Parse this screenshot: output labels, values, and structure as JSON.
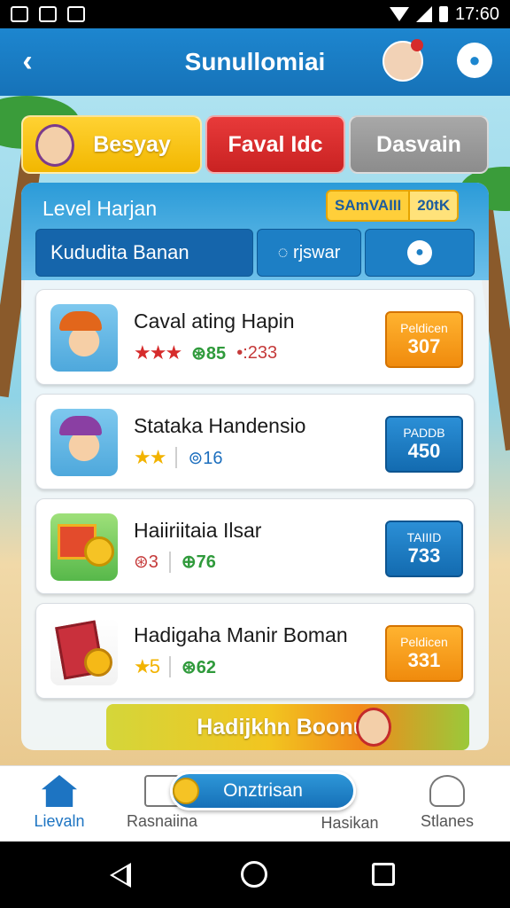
{
  "status_bar": {
    "time": "17:60"
  },
  "app_bar": {
    "title": "Sunullomiai"
  },
  "tabs": [
    {
      "label": "Besyay"
    },
    {
      "label": "Faval Idc"
    },
    {
      "label": "Dasvain"
    }
  ],
  "panel": {
    "title": "Level Harjan",
    "pill_a": "SAmVAIII",
    "pill_b": "20tK",
    "filters": [
      {
        "label": "Kududita Banan"
      },
      {
        "label": "◌ rjswar"
      }
    ]
  },
  "items": [
    {
      "name": "Caval ating Hapin",
      "stars": "★★★",
      "stat1": "⊛85",
      "stat2": "•:233",
      "price_label": "Peldicen",
      "price": "307",
      "price_style": "orange"
    },
    {
      "name": "Stataka Handensio",
      "stars": "★★",
      "stat1": "⊚16",
      "price_label": "PADDB",
      "price": "450",
      "price_style": "blue"
    },
    {
      "name": "Haiiriitaia Ilsar",
      "stars": "",
      "stat1": "⊛3",
      "stat2": "⊕76",
      "price_label": "TAIIID",
      "price": "733",
      "price_style": "blue"
    },
    {
      "name": "Hadigaha Manir Boman",
      "stars": "★5",
      "stat1": "⊛62",
      "price_label": "Peldicen",
      "price": "331",
      "price_style": "orange"
    }
  ],
  "bonus": {
    "label": "Hadijkhn Boonus"
  },
  "bottom_nav": {
    "home": "Lievaln",
    "item2": "Rasnaiina",
    "center": "Onztrisan",
    "item4": "Hasikan",
    "item5": "Stlanes"
  }
}
